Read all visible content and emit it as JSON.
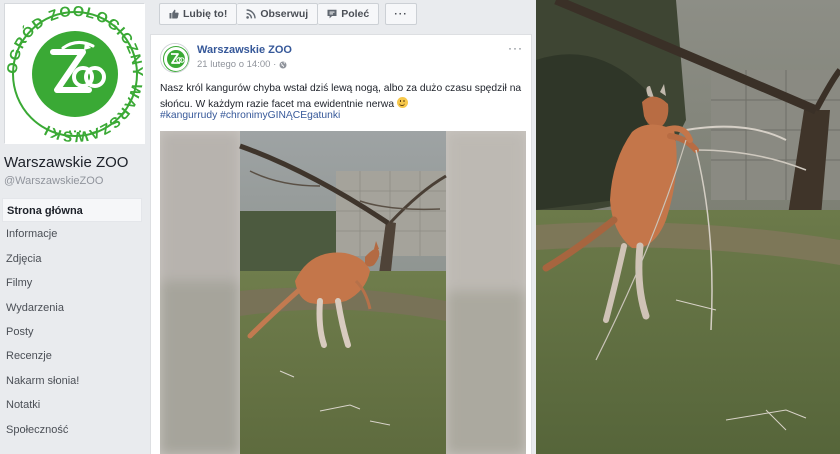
{
  "logo": {
    "ring_text": "OGRÓD ZOOLOGICZNY WARSZAWSKI",
    "mark": "ZOO"
  },
  "page": {
    "name": "Warszawskie ZOO",
    "handle": "@WarszawskieZOO"
  },
  "nav": {
    "items": [
      {
        "label": "Strona główna",
        "active": true
      },
      {
        "label": "Informacje"
      },
      {
        "label": "Zdjęcia"
      },
      {
        "label": "Filmy"
      },
      {
        "label": "Wydarzenia"
      },
      {
        "label": "Posty"
      },
      {
        "label": "Recenzje"
      },
      {
        "label": "Nakarm słonia!"
      },
      {
        "label": "Notatki"
      },
      {
        "label": "Społeczność"
      }
    ]
  },
  "actions": {
    "like": "Lubię to!",
    "follow": "Obserwuj",
    "share": "Poleć",
    "more": "···"
  },
  "post": {
    "author": "Warszawskie ZOO",
    "date": "21 lutego o 14:00 ·",
    "menu": "···",
    "text": "Nasz król kangurów chyba wstał dziś lewą nogą, albo za dużo czasu spędził na słońcu. W każdym razie facet ma ewidentnie nerwa",
    "hashtags": [
      "#kangurrudy",
      "#chronimyGINĄCEgatunki"
    ]
  },
  "colors": {
    "fb_bg": "#e9ebee",
    "link": "#365899",
    "logo_green": "#3aa935",
    "kangaroo": "#c4764a"
  },
  "icons": {
    "like": "thumbs-up-icon",
    "follow": "rss-icon",
    "share": "share-icon",
    "date": "globe-icon"
  }
}
